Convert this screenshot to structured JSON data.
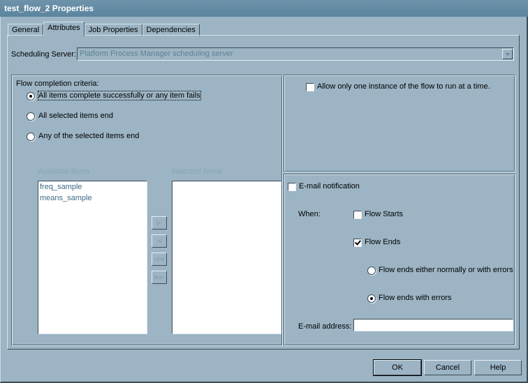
{
  "window": {
    "title": "test_flow_2 Properties"
  },
  "tabs": [
    {
      "label": "General",
      "active": false
    },
    {
      "label": "Attributes",
      "active": true
    },
    {
      "label": "Job Properties",
      "active": false
    },
    {
      "label": "Dependencies",
      "active": false
    }
  ],
  "scheduling_server": {
    "label": "Scheduling Server:",
    "value": "Platform Process Manager scheduling server"
  },
  "completion": {
    "label": "Flow completion criteria:",
    "options": [
      {
        "label": "All items complete successfully or any item fails",
        "selected": true
      },
      {
        "label": "All selected items end",
        "selected": false
      },
      {
        "label": "Any of the selected items end",
        "selected": false
      }
    ],
    "available_label": "Available Items",
    "selected_label": "Selected Items",
    "available_items": [
      "freq_sample",
      "means_sample"
    ],
    "selected_items": [],
    "move_buttons": [
      "▶",
      "◀",
      "◀◀",
      "▶▶"
    ]
  },
  "single_instance": {
    "label": "Allow only one instance of the flow to run at a time.",
    "checked": false
  },
  "email": {
    "label": "E-mail notification",
    "checked": false,
    "when_label": "When:",
    "flow_starts": {
      "label": "Flow Starts",
      "checked": false
    },
    "flow_ends": {
      "label": "Flow Ends",
      "checked": true
    },
    "end_options": [
      {
        "label": "Flow ends either normally or with errors",
        "selected": false
      },
      {
        "label": "Flow ends with errors",
        "selected": true
      }
    ],
    "address_label": "E-mail address:",
    "address_value": ""
  },
  "buttons": {
    "ok": "OK",
    "cancel": "Cancel",
    "help": "Help"
  }
}
